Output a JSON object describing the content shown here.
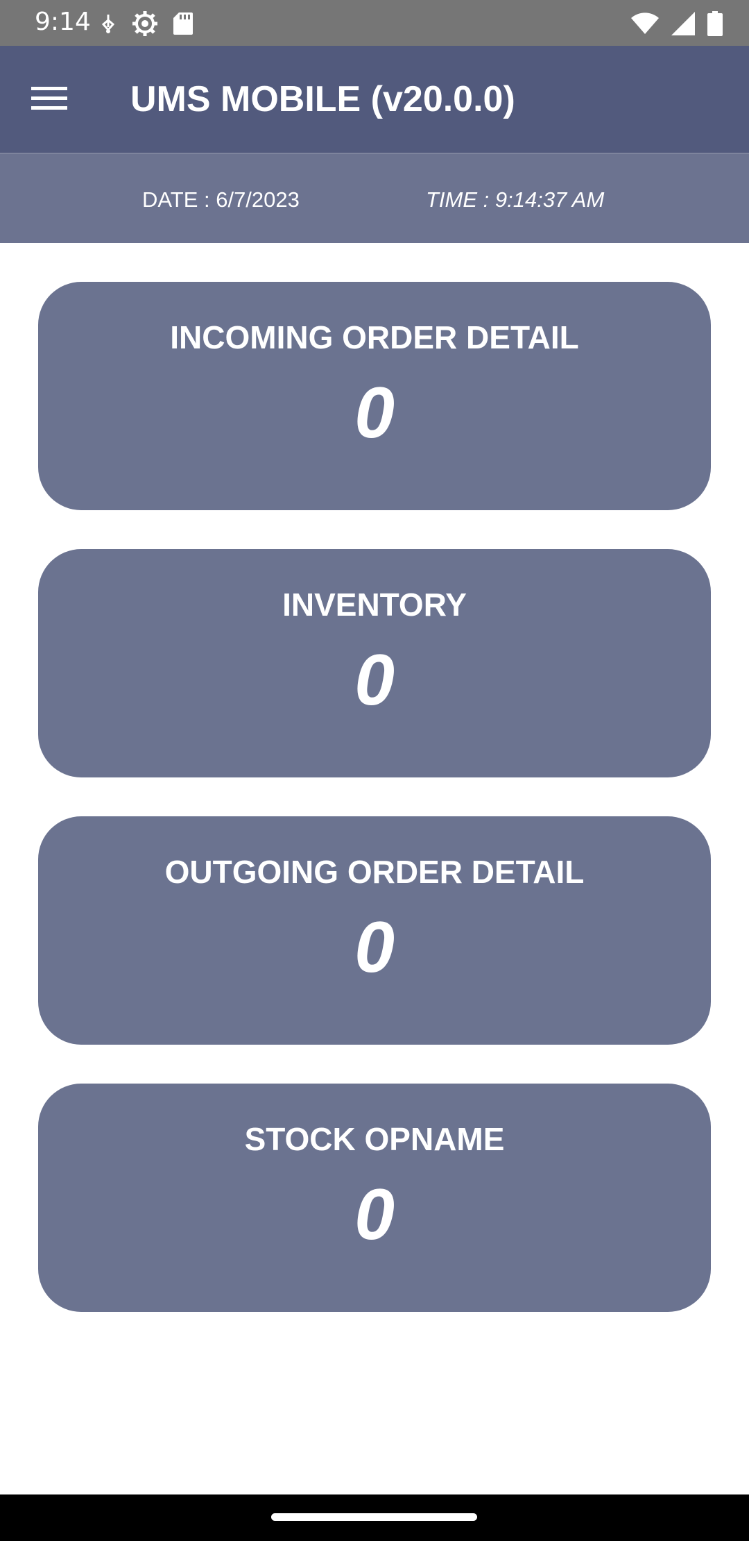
{
  "status_bar": {
    "time": "9:14",
    "icons_left": [
      "usb-debug-icon",
      "settings-gear-icon",
      "sd-card-icon"
    ],
    "icons_right": [
      "wifi-icon",
      "signal-icon",
      "battery-icon"
    ]
  },
  "app_bar": {
    "title": "UMS MOBILE (v20.0.0)",
    "menu_icon": "hamburger-menu-icon"
  },
  "datetime": {
    "date": "DATE : 6/7/2023",
    "time": "TIME : 9:14:37 AM"
  },
  "cards": [
    {
      "title": "INCOMING ORDER DETAIL",
      "value": "0"
    },
    {
      "title": "INVENTORY",
      "value": "0"
    },
    {
      "title": "OUTGOING ORDER DETAIL",
      "value": "0"
    },
    {
      "title": "STOCK OPNAME",
      "value": "0"
    }
  ],
  "colors": {
    "status_bar": "#767676",
    "app_bar": "#525a7d",
    "datetime_bar": "#6c7390",
    "card": "#6b7390",
    "text": "#ffffff"
  }
}
